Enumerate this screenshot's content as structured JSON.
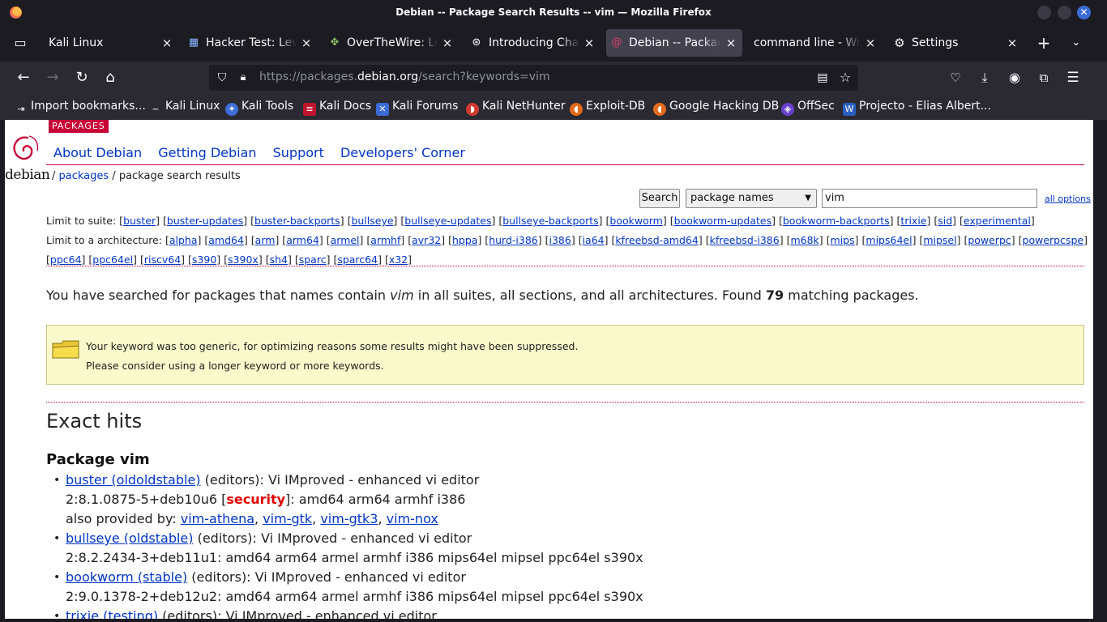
{
  "window": {
    "title": "Debian -- Package Search Results -- vim — Mozilla Firefox"
  },
  "tabs": [
    {
      "label": "Kali Linux",
      "icon": "kali-icon"
    },
    {
      "label": "Hacker Test: Level",
      "icon": "grid-icon"
    },
    {
      "label": "OverTheWire: Level",
      "icon": "overthewire-icon"
    },
    {
      "label": "Introducing ChatGPT",
      "icon": "openai-icon"
    },
    {
      "label": "Debian -- Package",
      "icon": "debian-icon",
      "active": true
    },
    {
      "label": "command line - Writ",
      "icon": "none"
    },
    {
      "label": "Settings",
      "icon": "gear-icon"
    }
  ],
  "urlbar": {
    "prefix": "https://packages.",
    "domain": "debian.org",
    "path": "/search?keywords=vim"
  },
  "bookmarks": [
    {
      "label": "Import bookmarks...",
      "icon": "import-icon",
      "color": "#2b2a33"
    },
    {
      "label": "Kali Linux",
      "icon": "kali-icon",
      "color": "#2b2a33"
    },
    {
      "label": "Kali Tools",
      "icon": "kali-tools-icon",
      "color": "#3d6fd9"
    },
    {
      "label": "Kali Docs",
      "icon": "kali-docs-icon",
      "color": "#c0152f"
    },
    {
      "label": "Kali Forums",
      "icon": "kali-forums-icon",
      "color": "#3b6bd6"
    },
    {
      "label": "Kali NetHunter",
      "icon": "nethunter-icon",
      "color": "#d13b2e"
    },
    {
      "label": "Exploit-DB",
      "icon": "exploitdb-icon",
      "color": "#e36a1b"
    },
    {
      "label": "Google Hacking DB",
      "icon": "ghdb-icon",
      "color": "#e36a1b"
    },
    {
      "label": "OffSec",
      "icon": "offsec-icon",
      "color": "#6a3fd0"
    },
    {
      "label": "Projecto - Elias Albert...",
      "icon": "word-icon",
      "color": "#2b5fbf"
    }
  ],
  "site": {
    "logo_word": "debian",
    "badge": "PACKAGES",
    "nav": [
      "About Debian",
      "Getting Debian",
      "Support",
      "Developers' Corner"
    ],
    "breadcrumb": {
      "sep1": "/ ",
      "link": "packages",
      "rest": " / package search results"
    },
    "search": {
      "button": "Search",
      "select_value": "package names",
      "input_value": "vim",
      "all_options": "all options"
    },
    "suite_label": "Limit to suite:",
    "suites": [
      "buster",
      "buster-updates",
      "buster-backports",
      "bullseye",
      "bullseye-updates",
      "bullseye-backports",
      "bookworm",
      "bookworm-updates",
      "bookworm-backports",
      "trixie",
      "sid",
      "experimental"
    ],
    "arch_label": "Limit to a architecture:",
    "archs": [
      "alpha",
      "amd64",
      "arm",
      "arm64",
      "armel",
      "armhf",
      "avr32",
      "hppa",
      "hurd-i386",
      "i386",
      "ia64",
      "kfreebsd-amd64",
      "kfreebsd-i386",
      "m68k",
      "mips",
      "mips64el",
      "mipsel",
      "powerpc",
      "powerpcspe",
      "ppc64",
      "ppc64el",
      "riscv64",
      "s390",
      "s390x",
      "sh4",
      "sparc",
      "sparc64",
      "x32"
    ],
    "found": {
      "pre": "You have searched for packages that names contain ",
      "kw": "vim",
      "mid": " in all suites, all sections, and all architectures. Found ",
      "count": "79",
      "post": " matching packages."
    },
    "warning": {
      "line1": "Your keyword was too generic, for optimizing reasons some results might have been suppressed.",
      "line2": "Please consider using a longer keyword or more keywords."
    },
    "exact_heading": "Exact hits",
    "package_heading": "Package vim",
    "hits": [
      {
        "suite": "buster (oldoldstable)",
        "desc": " (editors): Vi IMproved - enhanced vi editor",
        "ver": "2:8.1.0875-5+deb10u6 [",
        "security": "security",
        "arches": "]: amd64 arm64 armhf i386",
        "also_label": "also provided by: ",
        "also": [
          "vim-athena",
          "vim-gtk",
          "vim-gtk3",
          "vim-nox"
        ]
      },
      {
        "suite": "bullseye (oldstable)",
        "desc": " (editors): Vi IMproved - enhanced vi editor",
        "ver": "2:8.2.2434-3+deb11u1: amd64 arm64 armel armhf i386 mips64el mipsel ppc64el s390x"
      },
      {
        "suite": "bookworm (stable)",
        "desc": " (editors): Vi IMproved - enhanced vi editor",
        "ver": "2:9.0.1378-2+deb12u2: amd64 arm64 armel armhf i386 mips64el mipsel ppc64el s390x"
      },
      {
        "suite": "trixie (testing)",
        "desc": " (editors): Vi IMproved - enhanced vi editor"
      }
    ]
  }
}
